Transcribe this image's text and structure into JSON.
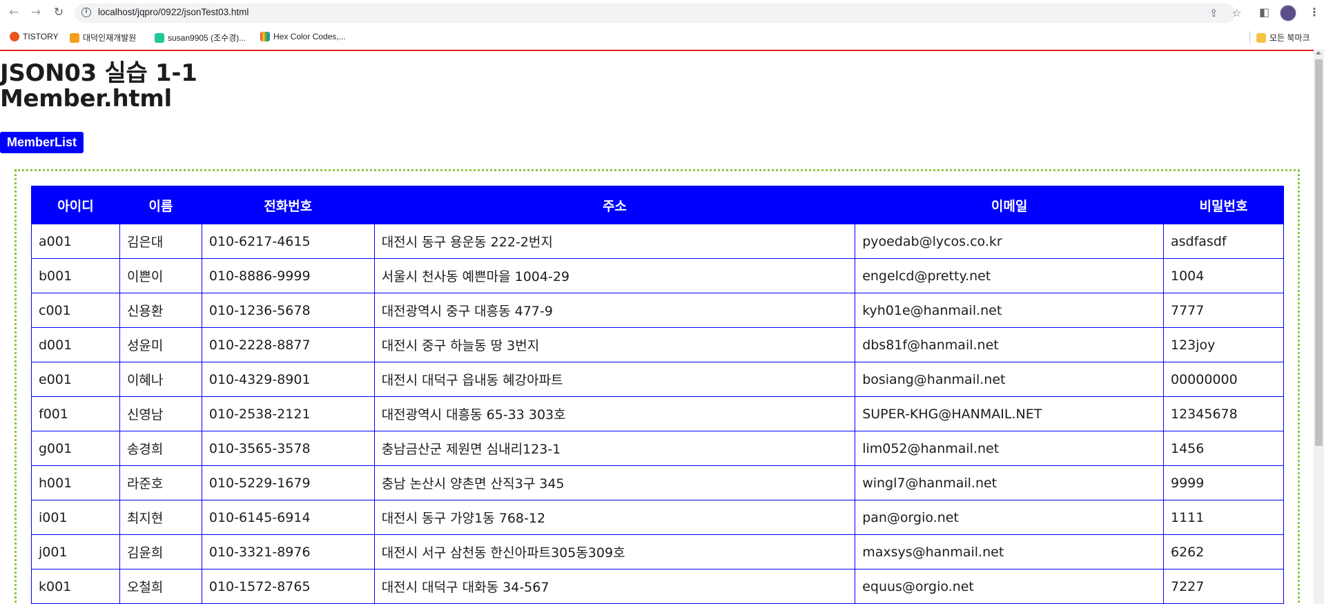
{
  "browser": {
    "url": "localhost/jqpro/0922/jsonTest03.html",
    "bookmarks": [
      {
        "label": "TISTORY",
        "color": "#eb531f"
      },
      {
        "label": "대덕인재개발원",
        "color": "#f29f1f"
      },
      {
        "label": "susan9905 (조수경)...",
        "color": "#20c997"
      },
      {
        "label": "Hex Color Codes,...",
        "color": "#3366cc"
      }
    ],
    "all_bookmarks": "모든 북마크"
  },
  "page": {
    "title": "JSON03 실습 1-1",
    "subtitle": "Member.html",
    "button_label": "MemberList"
  },
  "table": {
    "headers": [
      "아이디",
      "이름",
      "전화번호",
      "주소",
      "이메일",
      "비밀번호"
    ],
    "rows": [
      [
        "a001",
        "김은대",
        "010-6217-4615",
        "대전시 동구 용운동 222-2번지",
        "pyoedab@lycos.co.kr",
        "asdfasdf"
      ],
      [
        "b001",
        "이쁜이",
        "010-8886-9999",
        "서울시 천사동 예쁜마을 1004-29",
        "engelcd@pretty.net",
        "1004"
      ],
      [
        "c001",
        "신용환",
        "010-1236-5678",
        "대전광역시 중구 대흥동 477-9",
        "kyh01e@hanmail.net",
        "7777"
      ],
      [
        "d001",
        "성윤미",
        "010-2228-8877",
        "대전시 중구 하늘동 땅 3번지",
        "dbs81f@hanmail.net",
        "123joy"
      ],
      [
        "e001",
        "이혜나",
        "010-4329-8901",
        "대전시 대덕구 읍내동 혜강아파트",
        "bosiang@hanmail.net",
        "00000000"
      ],
      [
        "f001",
        "신영남",
        "010-2538-2121",
        "대전광역시 대흥동 65-33 303호",
        "SUPER-KHG@HANMAIL.NET",
        "12345678"
      ],
      [
        "g001",
        "송경희",
        "010-3565-3578",
        "충남금산군 제원면 심내리123-1",
        "lim052@hanmail.net",
        "1456"
      ],
      [
        "h001",
        "라준호",
        "010-5229-1679",
        "충남 논산시 양촌면 산직3구 345",
        "wingl7@hanmail.net",
        "9999"
      ],
      [
        "i001",
        "최지현",
        "010-6145-6914",
        "대전시 동구 가양1동 768-12",
        "pan@orgio.net",
        "1111"
      ],
      [
        "j001",
        "김윤희",
        "010-3321-8976",
        "대전시 서구 삼천동 한신아파트305동309호",
        "maxsys@hanmail.net",
        "6262"
      ],
      [
        "k001",
        "오철희",
        "010-1572-8765",
        "대전시 대덕구 대화동 34-567",
        "equus@orgio.net",
        "7227"
      ]
    ]
  },
  "colors": {
    "accent": "#0000ff",
    "dotted_border": "#8cc63f",
    "page_line": "#e01e1e"
  }
}
